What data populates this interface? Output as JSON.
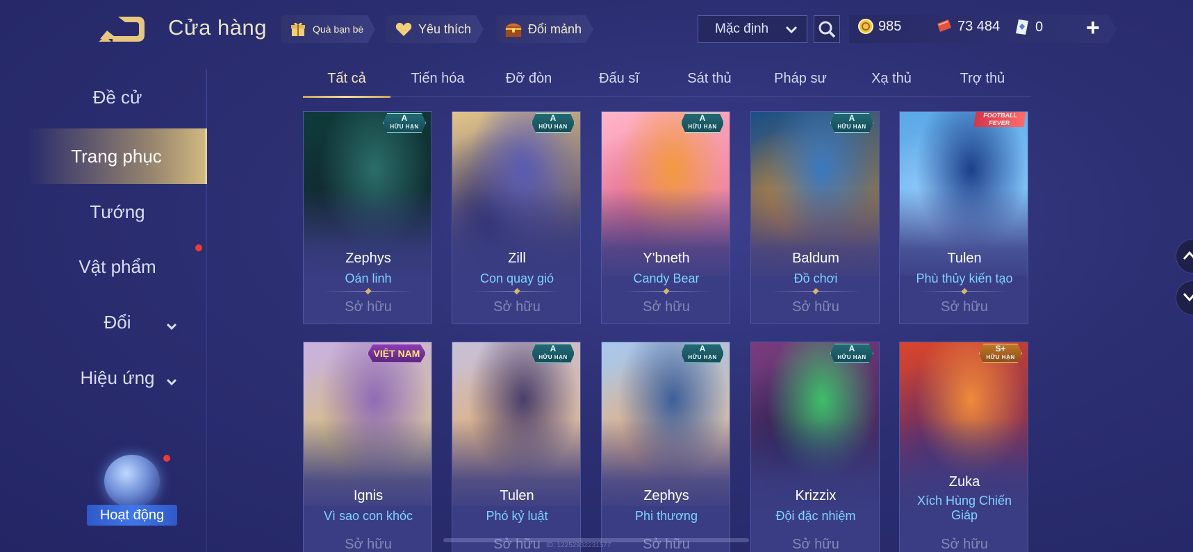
{
  "header": {
    "title": "Cửa hàng",
    "buttons": [
      {
        "label": "Quà bạn bè",
        "icon": "gift-icon"
      },
      {
        "label": "Yêu thích",
        "icon": "heart-icon"
      },
      {
        "label": "Đổi mảnh",
        "icon": "chest-icon"
      }
    ],
    "sort": {
      "value": "Mặc định"
    },
    "currencies": [
      {
        "icon": "gold-coin-icon",
        "value": "985"
      },
      {
        "icon": "voucher-icon",
        "value": "73 484"
      },
      {
        "icon": "diamond-card-icon",
        "value": "0"
      }
    ],
    "plus": "+"
  },
  "sidebar": {
    "items": [
      {
        "label": "Đề cử"
      },
      {
        "label": "Trang phục"
      },
      {
        "label": "Tướng"
      },
      {
        "label": "Vật phẩm"
      },
      {
        "label": "Đổi"
      },
      {
        "label": "Hiệu ứng"
      }
    ],
    "activity": {
      "label": "Hoạt động"
    }
  },
  "tabs": [
    "Tất cả",
    "Tiến hóa",
    "Đỡ đòn",
    "Đấu sĩ",
    "Sát thủ",
    "Pháp sư",
    "Xạ thủ",
    "Trợ thủ"
  ],
  "cards": [
    {
      "hero": "Zephys",
      "skin": "Oán linh",
      "status": "Sở hữu",
      "badge_rank": "A",
      "badge_limit": "HỮU HẠN",
      "colors": [
        "#0f3a3a",
        "#2b6e6a",
        "#12262e"
      ]
    },
    {
      "hero": "Zill",
      "skin": "Con quay gió",
      "status": "Sở hữu",
      "badge_rank": "A",
      "badge_limit": "HỮU HẠN",
      "colors": [
        "#e3c58a",
        "#5a5bb3",
        "#2a2a6a"
      ]
    },
    {
      "hero": "Y'bneth",
      "skin": "Candy Bear",
      "status": "Sở hữu",
      "badge_rank": "A",
      "badge_limit": "HỮU HẠN",
      "colors": [
        "#ffb4c8",
        "#f39a40",
        "#e36a8c"
      ]
    },
    {
      "hero": "Baldum",
      "skin": "Đồ chơi",
      "status": "Sở hữu",
      "badge_rank": "A",
      "badge_limit": "HỮU HẠN",
      "colors": [
        "#1b4f86",
        "#3a78c0",
        "#c98a3a"
      ]
    },
    {
      "hero": "Tulen",
      "skin": "Phù thủy kiến tạo",
      "status": "Sở hữu",
      "badge_rank": "FOOTBALL FEVER",
      "badge_limit": "",
      "colors": [
        "#5aa8e6",
        "#1c3f8a",
        "#9bd0ff"
      ]
    },
    {
      "hero": "Ignis",
      "skin": "Vì sao con khóc",
      "status": "Sở hữu",
      "badge_rank": "VIỆT NAM",
      "badge_limit": "",
      "colors": [
        "#c9b2e0",
        "#8f6bb6",
        "#d8c07a"
      ]
    },
    {
      "hero": "Tulen",
      "skin": "Phó kỷ luật",
      "status": "Sở hữu",
      "badge_rank": "A",
      "badge_limit": "HỮU HẠN",
      "colors": [
        "#c8c0d8",
        "#4a3e6a",
        "#e0b07a"
      ]
    },
    {
      "hero": "Zephys",
      "skin": "Phi thương",
      "status": "Sở hữu",
      "badge_rank": "A",
      "badge_limit": "HỮU HẠN",
      "colors": [
        "#a8c8ee",
        "#3d5f9a",
        "#e7b080"
      ]
    },
    {
      "hero": "Krizzix",
      "skin": "Đội đặc nhiệm",
      "status": "Sở hữu",
      "badge_rank": "A",
      "badge_limit": "HỮU HẠN",
      "colors": [
        "#7a3c7e",
        "#3fbf6a",
        "#2a2050"
      ]
    },
    {
      "hero": "Zuka",
      "skin": "Xích Hùng Chiến Giáp",
      "status": "Sở hữu",
      "badge_rank": "S+",
      "badge_limit": "HỮU HẠN",
      "colors": [
        "#d8452c",
        "#f08a3a",
        "#5a2a6a"
      ]
    }
  ],
  "footer": {
    "uid": "ID: 12252932231577"
  }
}
